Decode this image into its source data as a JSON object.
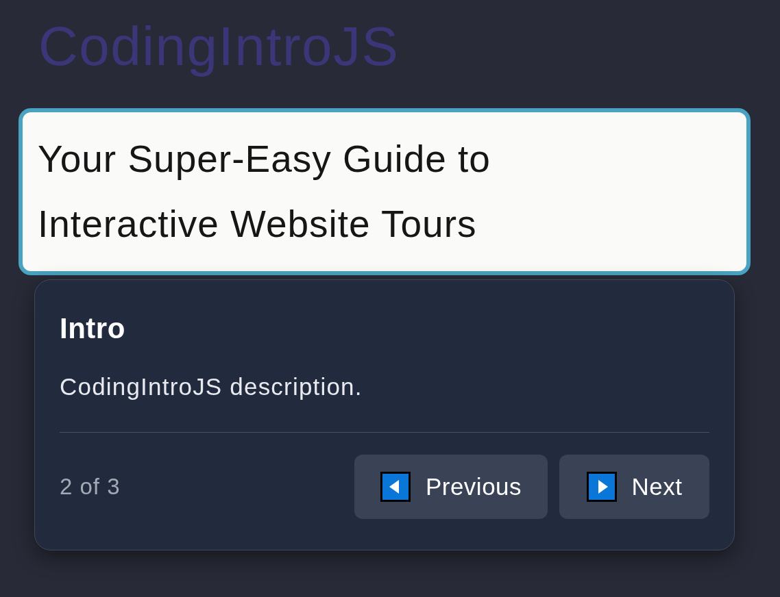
{
  "page": {
    "title": "CodingIntroJS",
    "headline": "Your Super-Easy Guide to Interactive Website Tours"
  },
  "tour_popover": {
    "title": "Intro",
    "description": "CodingIntroJS description.",
    "progress": "2 of 3",
    "buttons": [
      {
        "label": "Previous",
        "kind": "previous"
      },
      {
        "label": "Next",
        "kind": "next"
      }
    ]
  }
}
